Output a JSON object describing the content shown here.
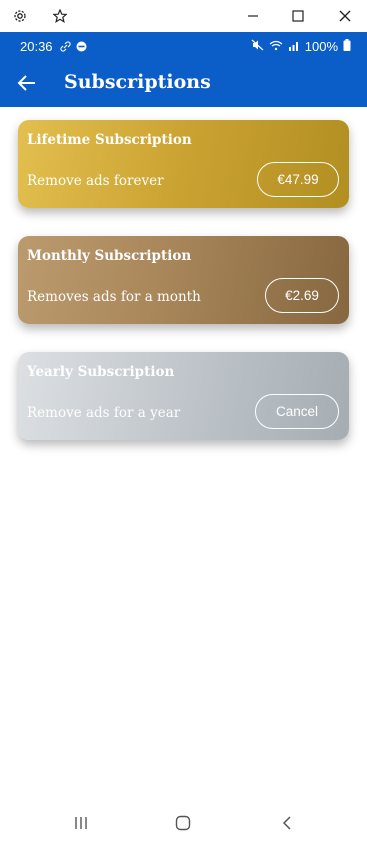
{
  "statusbar": {
    "time": "20:36",
    "battery": "100%"
  },
  "appbar": {
    "title": "Subscriptions"
  },
  "subscriptions": [
    {
      "title": "Lifetime Subscription",
      "description": "Remove ads forever",
      "button": "€47.99"
    },
    {
      "title": "Monthly Subscription",
      "description": "Removes ads for a month",
      "button": "€2.69"
    },
    {
      "title": "Yearly Subscription",
      "description": "Remove ads for a year",
      "button": "Cancel"
    }
  ],
  "colors": {
    "primary": "#0b5ec7",
    "lifetime": "#caa232",
    "monthly": "#a8865a",
    "yearly": "#bfc5ca"
  },
  "icons": {
    "window": [
      "gear-icon",
      "star-icon",
      "minimize-icon",
      "maximize-icon",
      "close-icon"
    ],
    "nav": [
      "recent-apps-icon",
      "home-icon",
      "back-nav-icon"
    ]
  }
}
